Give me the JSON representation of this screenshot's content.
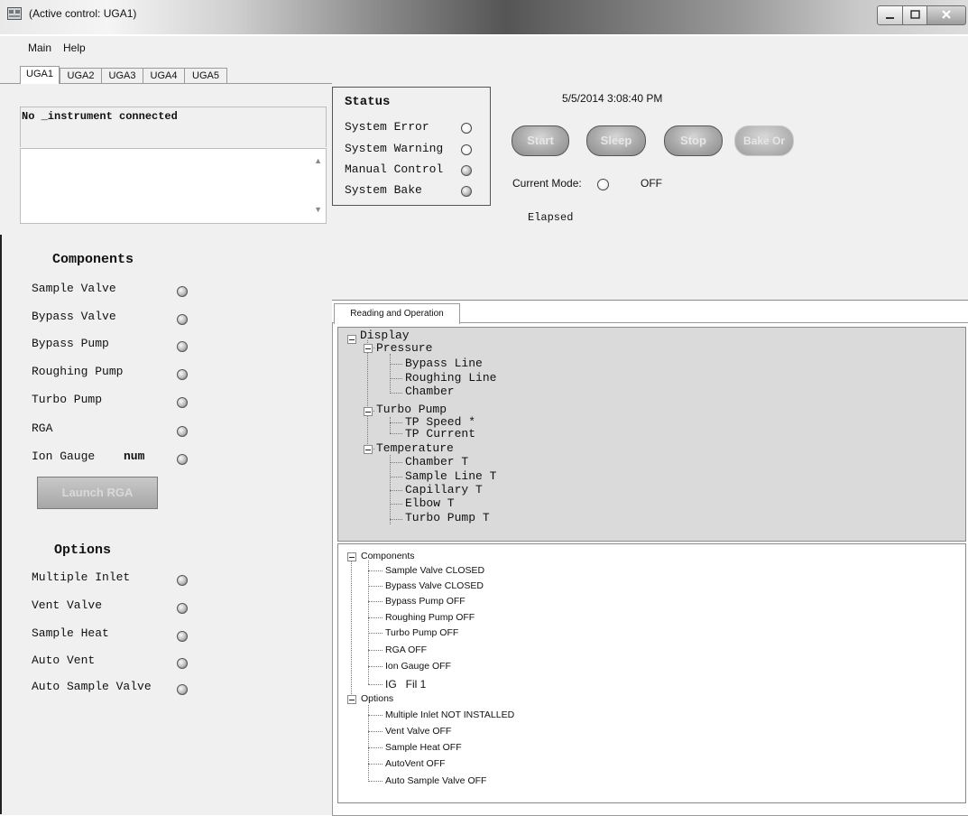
{
  "window": {
    "title": "(Active control: UGA1)"
  },
  "menu": {
    "items": [
      "Main",
      "Help"
    ]
  },
  "tabs": [
    "UGA1",
    "UGA2",
    "UGA3",
    "UGA4",
    "UGA5"
  ],
  "connection_text": "No _instrument connected",
  "components": {
    "heading": "Components",
    "items": [
      "Sample Valve",
      "Bypass Valve",
      "Bypass Pump",
      "Roughing Pump",
      "Turbo Pump",
      "RGA",
      "Ion Gauge"
    ],
    "ion_gauge_extra": "num",
    "launch_button": "Launch RGA"
  },
  "options": {
    "heading": "Options",
    "items": [
      "Multiple Inlet",
      "Vent Valve",
      "Sample Heat",
      "Auto Vent",
      "Auto Sample Valve"
    ]
  },
  "status": {
    "heading": "Status",
    "items": [
      "System Error",
      "System Warning",
      "Manual Control",
      "System Bake"
    ]
  },
  "datetime": "5/5/2014 3:08:40 PM",
  "buttons": {
    "start": "Start",
    "sleep": "Sleep",
    "stop": "Stop",
    "bake": "Bake Or"
  },
  "mode": {
    "label": "Current Mode:",
    "value": "OFF"
  },
  "elapsed_label": "Elapsed",
  "reading_tab": "Reading and Operation",
  "display_tree": {
    "root": "Display",
    "pressure": {
      "label": "Pressure",
      "items": [
        "Bypass Line",
        "Roughing Line",
        "Chamber"
      ]
    },
    "turbo": {
      "label": "Turbo Pump",
      "items": [
        "TP Speed *",
        "TP Current"
      ]
    },
    "temperature": {
      "label": "Temperature",
      "items": [
        "Chamber T",
        "Sample Line T",
        "Capillary T",
        "Elbow T",
        "Turbo Pump T"
      ]
    }
  },
  "status_tree": {
    "components_label": "Components",
    "components": [
      "Sample Valve  CLOSED",
      "Bypass Valve  CLOSED",
      "Bypass Pump  OFF",
      "Roughing Pump  OFF",
      "Turbo Pump  OFF",
      "RGA  OFF",
      "Ion Gauge  OFF",
      "IG   Fil 1"
    ],
    "options_label": "Options",
    "options": [
      "Multiple Inlet  NOT INSTALLED",
      "Vent Valve  OFF",
      "Sample Heat  OFF",
      "AutoVent  OFF",
      "Auto Sample Valve  OFF"
    ]
  }
}
